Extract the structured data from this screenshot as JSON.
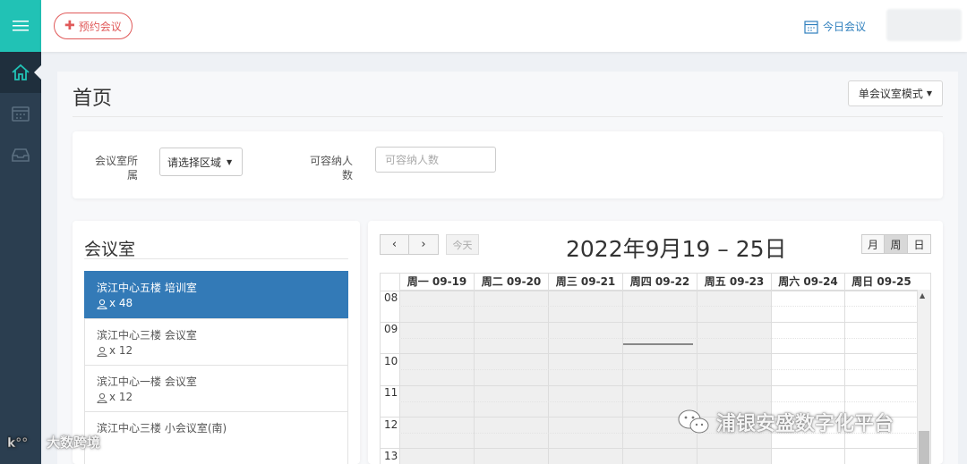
{
  "header": {
    "book_label": "预约会议",
    "today_label": "今日会议"
  },
  "page": {
    "title": "首页",
    "mode_label": "单会议室模式"
  },
  "filters": {
    "area_label": "会议室所属",
    "area_value": "请选择区域",
    "capacity_label": "可容纳人数",
    "capacity_placeholder": "可容纳人数"
  },
  "rooms": {
    "title": "会议室",
    "items": [
      {
        "name": "滨江中心五楼  培训室",
        "capacity": "x 48"
      },
      {
        "name": "滨江中心三楼  会议室",
        "capacity": "x 12"
      },
      {
        "name": "滨江中心一楼  会议室",
        "capacity": "x 12"
      },
      {
        "name": "滨江中心三楼  小会议室(南)",
        "capacity": ""
      }
    ]
  },
  "calendar": {
    "today_label": "今天",
    "title": "2022年9月19 – 25日",
    "views": [
      "月",
      "周",
      "日"
    ],
    "active_view": "周",
    "days": [
      "周一 09-19",
      "周二 09-20",
      "周三 09-21",
      "周四 09-22",
      "周五 09-23",
      "周六 09-24",
      "周日 09-25"
    ],
    "hours": [
      "08",
      "09",
      "10",
      "11",
      "12",
      "13"
    ]
  },
  "watermarks": {
    "left": "大数跨境",
    "right": "浦银安盛数字化平台"
  },
  "colors": {
    "sidebar": "#2b3e50",
    "sidebar_top": "#21c2b5",
    "accent_red": "#e05a5a",
    "active_room": "#337ab7",
    "link_blue": "#2f7fbd"
  }
}
